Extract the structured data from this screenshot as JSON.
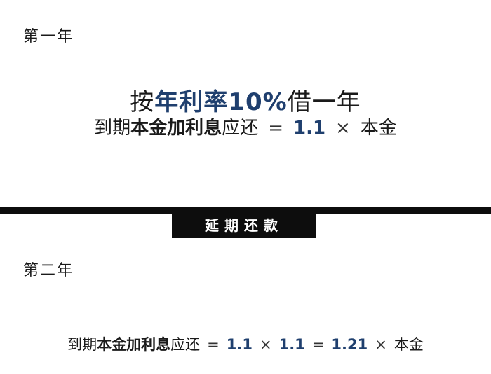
{
  "year1": {
    "label": "第一年",
    "line1": {
      "prefix": "按",
      "rate_text": "年利率10%",
      "suffix": "借一年"
    },
    "line2": {
      "prefix": "到期",
      "bold": "本金加利息",
      "suffix": "应还",
      "equals": "=",
      "factor": "1.1",
      "times": "×",
      "principal": "本金"
    }
  },
  "banner": {
    "label": "延期还款"
  },
  "year2": {
    "label": "第二年",
    "line": {
      "prefix": "到期",
      "bold": "本金加利息",
      "suffix": "应还",
      "equals1": "=",
      "factor1": "1.1",
      "times1": "×",
      "factor2": "1.1",
      "equals2": "=",
      "result": "1.21",
      "times2": "×",
      "principal": "本金"
    }
  }
}
